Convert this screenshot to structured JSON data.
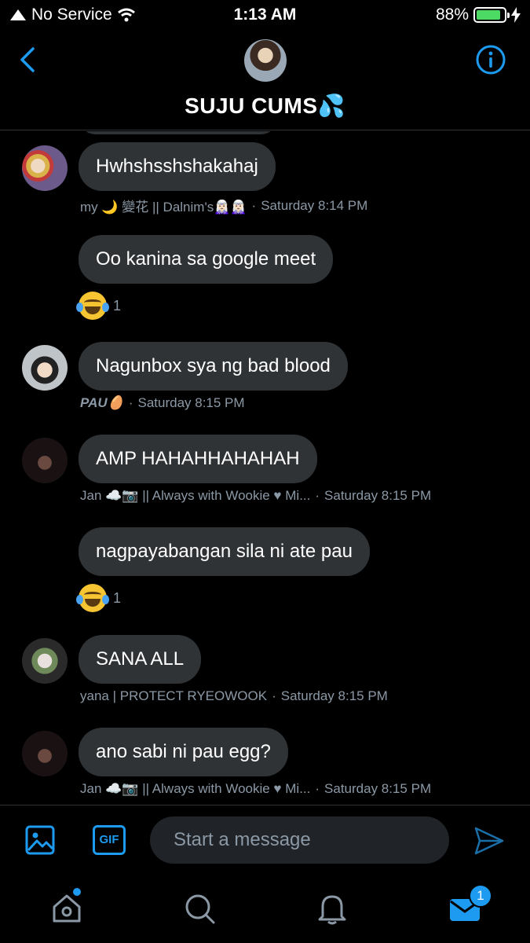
{
  "status_bar": {
    "carrier": "No Service",
    "time": "1:13 AM",
    "battery": "88%",
    "battery_level": 0.88
  },
  "header": {
    "title": "SUJU CUMS💦"
  },
  "messages": [
    {
      "text": "Hwhshsshshakahaj",
      "sender": "my 🌙 變花 || Dalnim's🧝🏻‍♀️🧝🏻‍♀️",
      "time": "Saturday 8:14 PM"
    },
    {
      "text": "Oo kanina sa google meet",
      "reaction_count": "1"
    },
    {
      "text": "Nagunbox sya ng bad blood",
      "sender": "PAU🥚",
      "time": "Saturday 8:15 PM"
    },
    {
      "text": "AMP HAHAHHAHAHAH",
      "sender": "Jan ☁️📷 || Always with Wookie ♥ Mi...",
      "time": "Saturday 8:15 PM"
    },
    {
      "text": "nagpayabangan sila ni ate pau",
      "reaction_count": "1"
    },
    {
      "text": "SANA ALL",
      "sender": "yana | PROTECT RYEOWOOK",
      "time": "Saturday 8:15 PM"
    },
    {
      "text": "ano sabi ni pau egg?",
      "sender": "Jan ☁️📷 || Always with Wookie ♥ Mi...",
      "time": "Saturday 8:15 PM"
    }
  ],
  "composer": {
    "gif_label": "GIF",
    "placeholder": "Start a message"
  },
  "tabbar": {
    "messages_badge": "1"
  },
  "colors": {
    "accent": "#1d9bf0",
    "bubble": "#2f3336",
    "meta": "#8b98a5"
  }
}
